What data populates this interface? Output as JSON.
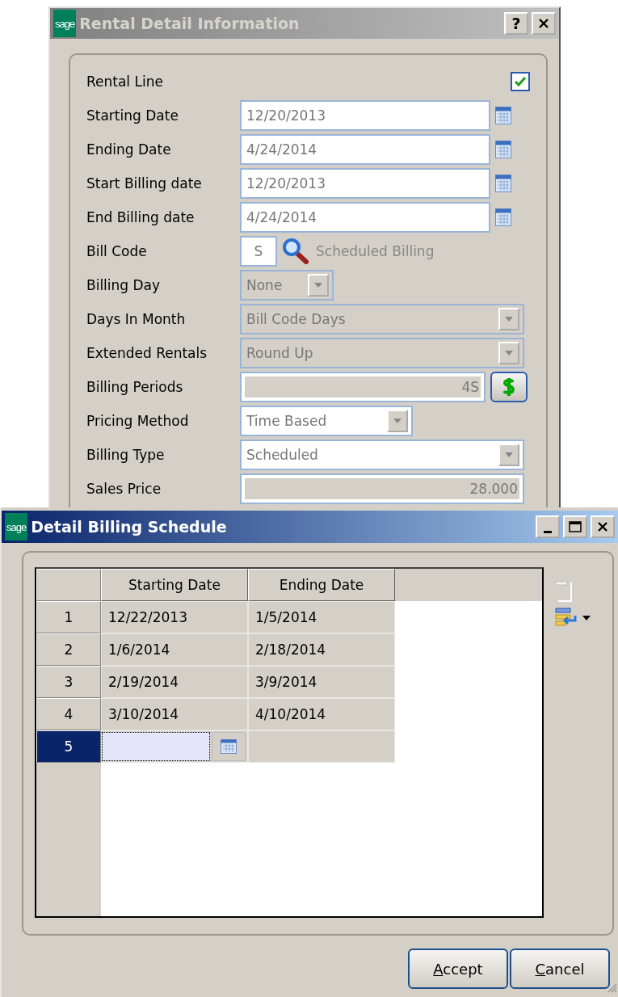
{
  "rental_window": {
    "logo": "sage",
    "title": "Rental Detail Information",
    "help_button": "?",
    "fields": [
      {
        "label": "Rental Line",
        "kind": "checkbox",
        "checked": true
      },
      {
        "label": "Starting Date",
        "kind": "date",
        "value": "12/20/2013"
      },
      {
        "label": "Ending Date",
        "kind": "date",
        "value": "4/24/2014"
      },
      {
        "label": "Start Billing date",
        "kind": "date",
        "value": "12/20/2013"
      },
      {
        "label": "End Billing date",
        "kind": "date",
        "value": "4/24/2014"
      },
      {
        "label": "Bill Code",
        "kind": "lookup",
        "value": "S",
        "description": "Scheduled Billing"
      },
      {
        "label": "Billing Day",
        "kind": "select",
        "value": "None",
        "disabled": true
      },
      {
        "label": "Days In Month",
        "kind": "select",
        "value": "Bill Code Days",
        "disabled": true
      },
      {
        "label": "Extended Rentals",
        "kind": "select",
        "value": "Round Up",
        "disabled": true
      },
      {
        "label": "Billing Periods",
        "kind": "number_button",
        "value": "4S"
      },
      {
        "label": "Pricing Method",
        "kind": "select",
        "value": "Time Based",
        "disabled": false
      },
      {
        "label": "Billing Type",
        "kind": "select",
        "value": "Scheduled",
        "disabled": false
      },
      {
        "label": "Sales Price",
        "kind": "number",
        "value": "28.000"
      }
    ]
  },
  "schedule_window": {
    "logo": "sage",
    "title": "Detail Billing Schedule",
    "columns": [
      "Starting Date",
      "Ending Date"
    ],
    "rows": [
      {
        "number": "1",
        "cells": [
          "12/22/2013",
          "1/5/2014"
        ],
        "selected": false
      },
      {
        "number": "2",
        "cells": [
          "1/6/2014",
          "2/18/2014"
        ],
        "selected": false
      },
      {
        "number": "3",
        "cells": [
          "2/19/2014",
          "3/9/2014"
        ],
        "selected": false
      },
      {
        "number": "4",
        "cells": [
          "3/10/2014",
          "4/10/2014"
        ],
        "selected": false
      },
      {
        "number": "5",
        "cells": [],
        "selected": true
      }
    ],
    "buttons": [
      "Accept",
      "Cancel"
    ]
  }
}
